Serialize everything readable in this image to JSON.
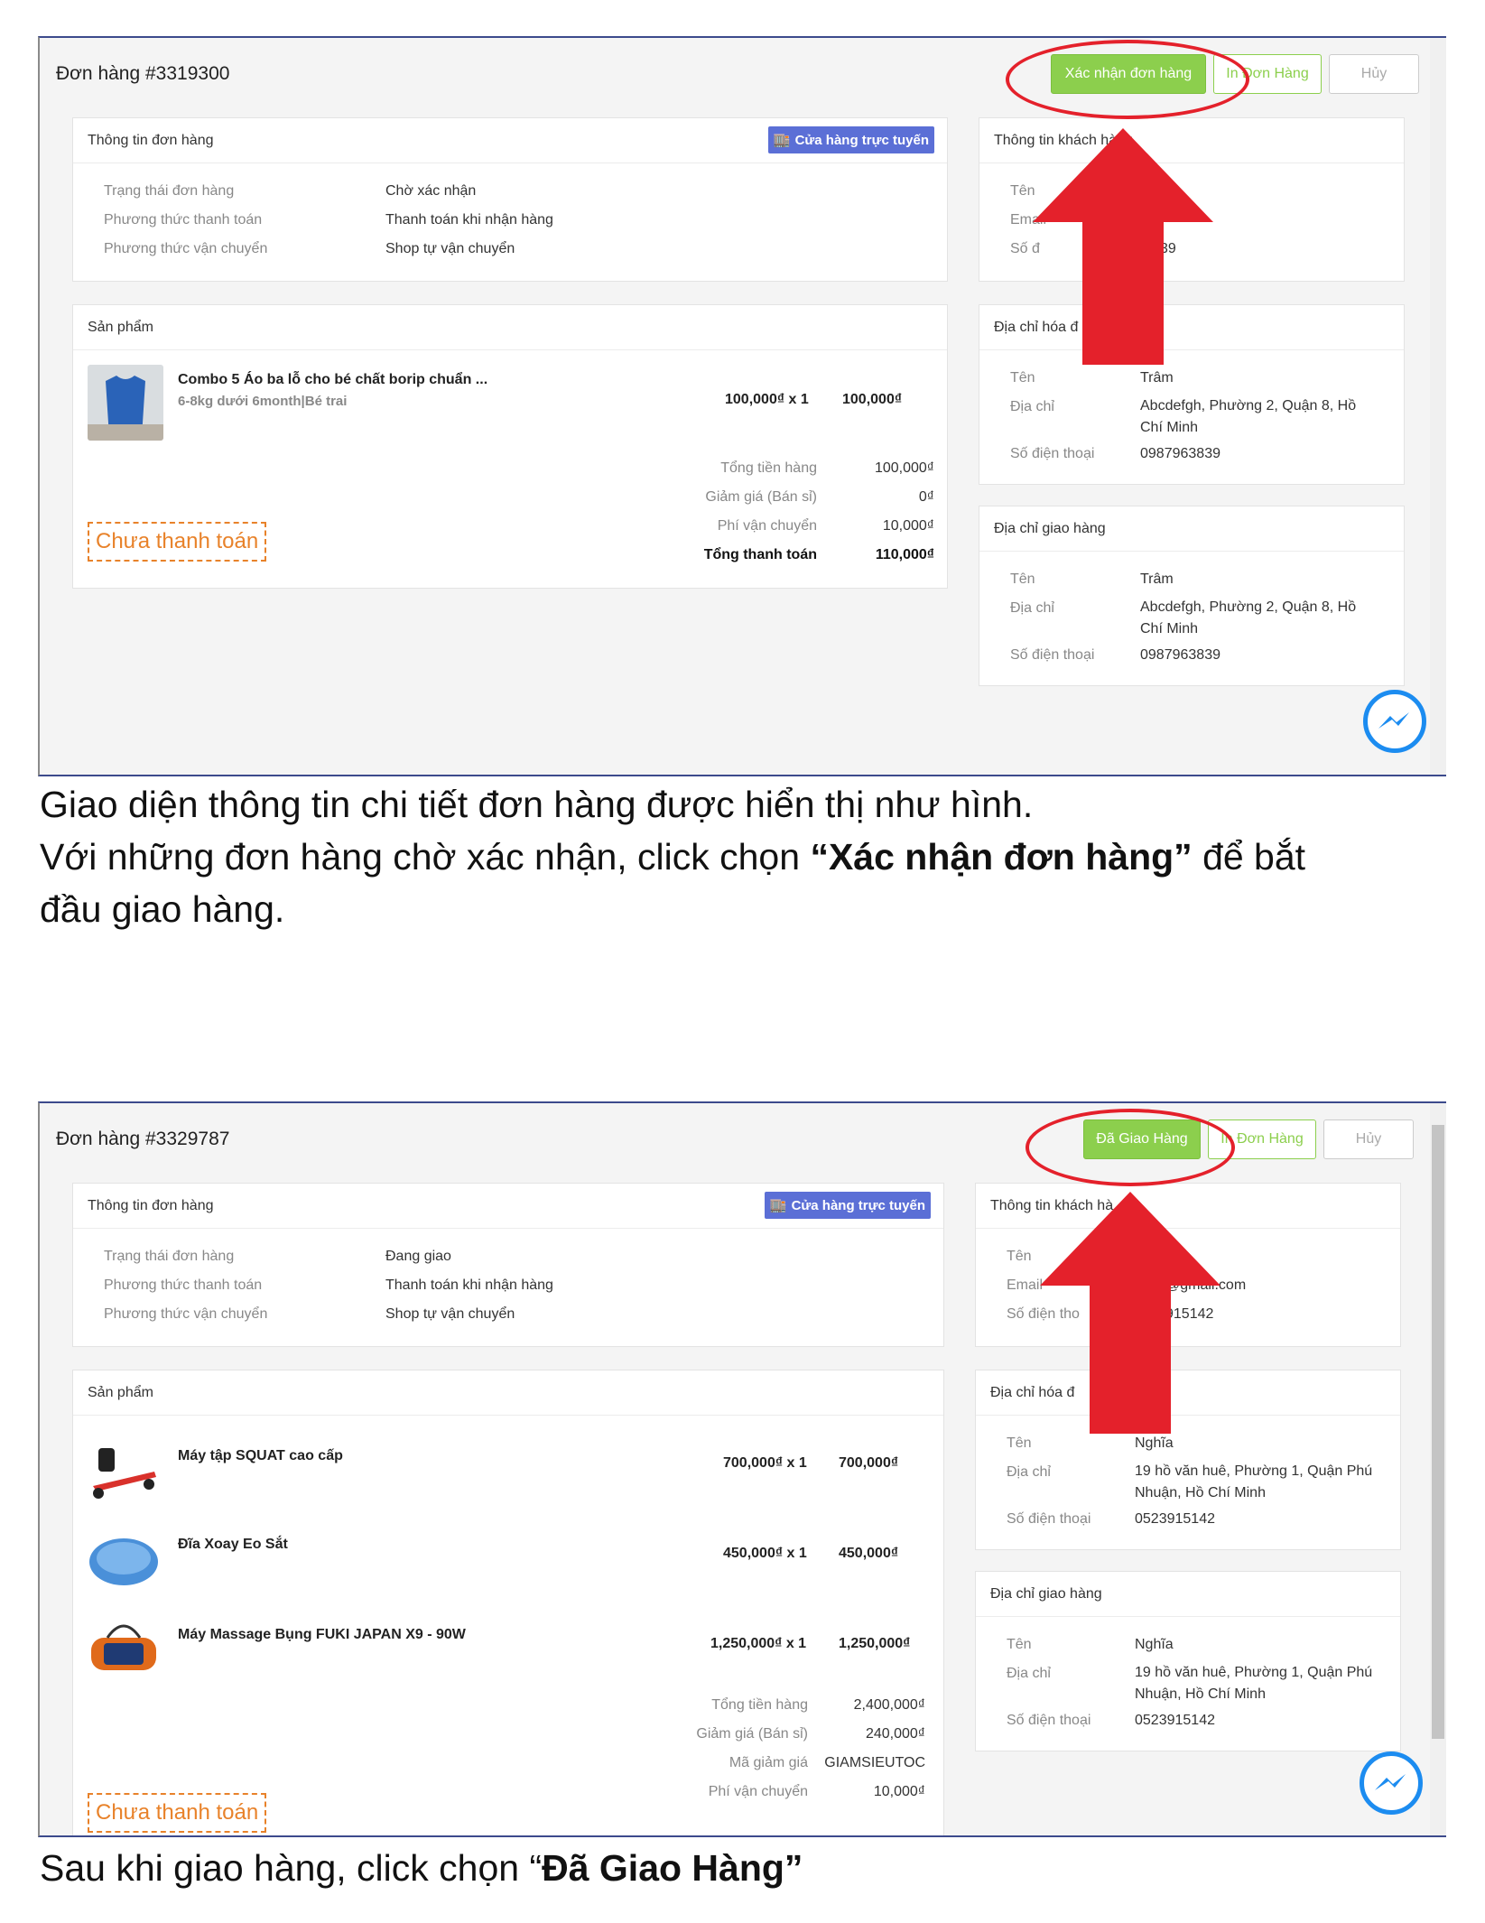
{
  "shot1": {
    "order_title": "Đơn hàng #3319300",
    "buttons": {
      "confirm": "Xác nhận đơn hàng",
      "print": "In Đơn Hàng",
      "cancel": "Hủy"
    },
    "order_info": {
      "heading": "Thông tin đơn hàng",
      "badge": "Cửa hàng trực tuyến",
      "rows": [
        {
          "key": "Trạng thái đơn hàng",
          "value": "Chờ xác nhận"
        },
        {
          "key": "Phương thức thanh toán",
          "value": "Thanh toán khi nhận hàng"
        },
        {
          "key": "Phương thức vận chuyển",
          "value": "Shop tự vận chuyển"
        }
      ]
    },
    "products": {
      "heading": "Sản phẩm",
      "items": [
        {
          "name": "Combo 5 Áo ba lỗ cho bé chất borip chuẩn ...",
          "variant": "6-8kg dưới 6month|Bé trai",
          "price_qty": "100,000₫ x 1",
          "total": "100,000₫"
        }
      ],
      "summary": [
        {
          "key": "Tổng tiền hàng",
          "value": "100,000₫"
        },
        {
          "key": "Giảm giá (Bán sỉ)",
          "value": "0₫"
        },
        {
          "key": "Phí vận chuyển",
          "value": "10,000₫"
        },
        {
          "key": "Tổng thanh toán",
          "value": "110,000₫"
        }
      ],
      "unpaid_label": "Chưa thanh toán"
    },
    "customer": {
      "heading": "Thông tin khách hàng",
      "rows": [
        {
          "key": "Tên",
          "value": "m"
        },
        {
          "key": "Email",
          "value": ""
        },
        {
          "key": "Số đ",
          "value": "39"
        }
      ]
    },
    "billing": {
      "heading": "Địa chỉ hóa đ",
      "rows": [
        {
          "key": "Tên",
          "value": "Trâm"
        },
        {
          "key": "Địa chỉ",
          "value": "Abcdefgh, Phường 2, Quận 8, Hồ Chí Minh"
        },
        {
          "key": "Số điện thoại",
          "value": "0987963839"
        }
      ]
    },
    "shipping": {
      "heading": "Địa chỉ giao hàng",
      "rows": [
        {
          "key": "Tên",
          "value": "Trâm"
        },
        {
          "key": "Địa chỉ",
          "value": "Abcdefgh, Phường 2, Quận 8, Hồ Chí Minh"
        },
        {
          "key": "Số điện thoại",
          "value": "0987963839"
        }
      ]
    }
  },
  "caption1": {
    "line1": "Giao diện thông tin chi tiết đơn hàng được hiển thị như hình.",
    "line2_pre": "Với những đơn hàng chờ xác nhận, click chọn ",
    "line2_bold": "“Xác nhận đơn hàng”",
    "line2_post": " để bắt",
    "line3": "đầu giao hàng."
  },
  "shot2": {
    "order_title": "Đơn hàng #3329787",
    "buttons": {
      "confirm": "Đã Giao Hàng",
      "print": "In Đơn Hàng",
      "cancel": "Hủy"
    },
    "order_info": {
      "heading": "Thông tin đơn hàng",
      "badge": "Cửa hàng trực tuyến",
      "rows": [
        {
          "key": "Trạng thái đơn hàng",
          "value": "Đang giao"
        },
        {
          "key": "Phương thức thanh toán",
          "value": "Thanh toán khi nhận hàng"
        },
        {
          "key": "Phương thức vận chuyển",
          "value": "Shop tự vận chuyển"
        }
      ]
    },
    "products": {
      "heading": "Sản phẩm",
      "items": [
        {
          "name": "Máy tập SQUAT cao cấp",
          "price_qty": "700,000₫ x 1",
          "total": "700,000₫"
        },
        {
          "name": "Đĩa Xoay Eo Sắt",
          "price_qty": "450,000₫ x 1",
          "total": "450,000₫"
        },
        {
          "name": "Máy Massage Bụng FUKI JAPAN X9 - 90W",
          "price_qty": "1,250,000₫ x 1",
          "total": "1,250,000₫"
        }
      ],
      "summary": [
        {
          "key": "Tổng tiền hàng",
          "value": "2,400,000₫"
        },
        {
          "key": "Giảm giá (Bán sỉ)",
          "value": "240,000₫"
        },
        {
          "key": "Mã giảm giá",
          "value": "GIAMSIEUTOC"
        },
        {
          "key": "Phí vận chuyển",
          "value": "10,000₫"
        }
      ],
      "unpaid_label": "Chưa thanh toán"
    },
    "customer": {
      "heading": "Thông tin khách hà",
      "rows": [
        {
          "key": "Tên",
          "value": ""
        },
        {
          "key": "Email",
          "value": "@gmail.com"
        },
        {
          "key": "Số điện tho",
          "value": "915142"
        }
      ]
    },
    "billing": {
      "heading": "Địa chỉ hóa đ",
      "rows": [
        {
          "key": "Tên",
          "value": "Nghĩa"
        },
        {
          "key": "Địa chỉ",
          "value": "19 hồ văn huê, Phường 1, Quận Phú Nhuận, Hồ Chí Minh"
        },
        {
          "key": "Số điện thoại",
          "value": "0523915142"
        }
      ]
    },
    "shipping": {
      "heading": "Địa chỉ giao hàng",
      "rows": [
        {
          "key": "Tên",
          "value": "Nghĩa"
        },
        {
          "key": "Địa chỉ",
          "value": "19 hồ văn huê, Phường 1, Quận Phú Nhuận, Hồ Chí Minh"
        },
        {
          "key": "Số điện thoại",
          "value": "0523915142"
        }
      ]
    }
  },
  "caption2": {
    "pre": "Sau khi giao hàng, click chọn “",
    "bold": "Đã Giao Hàng”"
  },
  "colors": {
    "accent_green": "#8ccf4d",
    "badge_blue": "#5b6fd6",
    "annotation_red": "#e4212b",
    "unpaid_orange": "#e8822a"
  }
}
